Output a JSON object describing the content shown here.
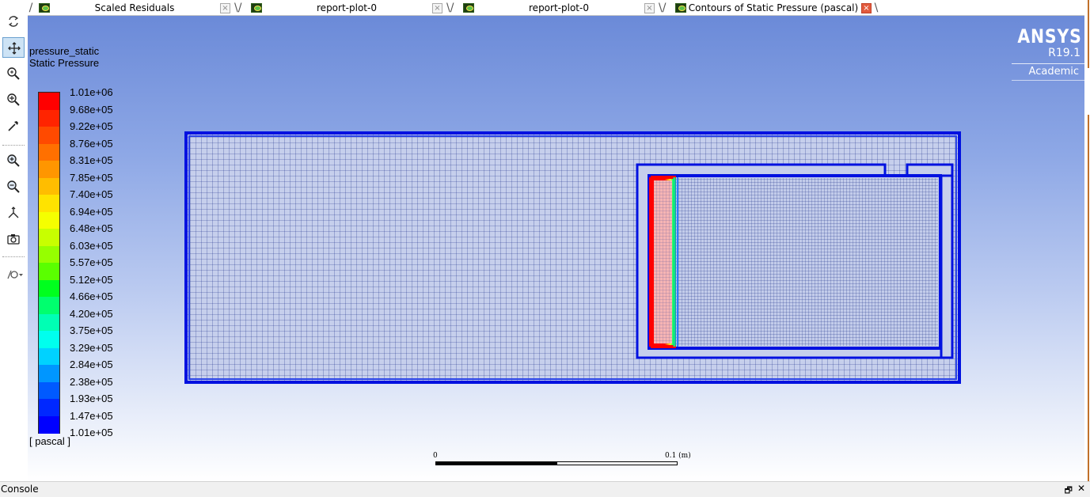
{
  "tabs": [
    {
      "label": "Scaled Residuals",
      "close": "×",
      "active": false
    },
    {
      "label": "report-plot-0",
      "close": "×",
      "active": false
    },
    {
      "label": "report-plot-0",
      "close": "×",
      "active": false
    },
    {
      "label": "Contours of Static Pressure (pascal)",
      "close": "×",
      "active": true
    }
  ],
  "toolbar": {
    "tools": [
      "rotate-icon",
      "pan-icon",
      "zoom-fit-icon",
      "zoom-in-region-icon",
      "probe-icon",
      "zoom-in-icon",
      "zoom-out-icon",
      "orient-icon",
      "camera-icon",
      "display-options-icon"
    ],
    "selected": "pan-icon"
  },
  "legend": {
    "variable": "pressure_static",
    "description": "Static Pressure",
    "units": "[ pascal ]",
    "levels": [
      "1.01e+06",
      "9.68e+05",
      "9.22e+05",
      "8.76e+05",
      "8.31e+05",
      "7.85e+05",
      "7.40e+05",
      "6.94e+05",
      "6.48e+05",
      "6.03e+05",
      "5.57e+05",
      "5.12e+05",
      "4.66e+05",
      "4.20e+05",
      "3.75e+05",
      "3.29e+05",
      "2.84e+05",
      "2.38e+05",
      "1.93e+05",
      "1.47e+05",
      "1.01e+05"
    ],
    "colors": [
      "#ff0000",
      "#ff2400",
      "#ff4a00",
      "#ff7000",
      "#ff9600",
      "#ffbd00",
      "#ffe300",
      "#f5ff00",
      "#c8ff00",
      "#96ff00",
      "#5aff00",
      "#00ff1e",
      "#00ff6e",
      "#00ffb4",
      "#00ffee",
      "#00d2ff",
      "#0096ff",
      "#005aff",
      "#0028ff",
      "#0000ff"
    ]
  },
  "logo": {
    "brand": "ANSYS",
    "release": "R19.1",
    "edition": "Academic"
  },
  "scale": {
    "zero": "0",
    "max": "0.1 (m)"
  },
  "console": {
    "title": "Console",
    "restore": "🗗",
    "close": "✕"
  }
}
